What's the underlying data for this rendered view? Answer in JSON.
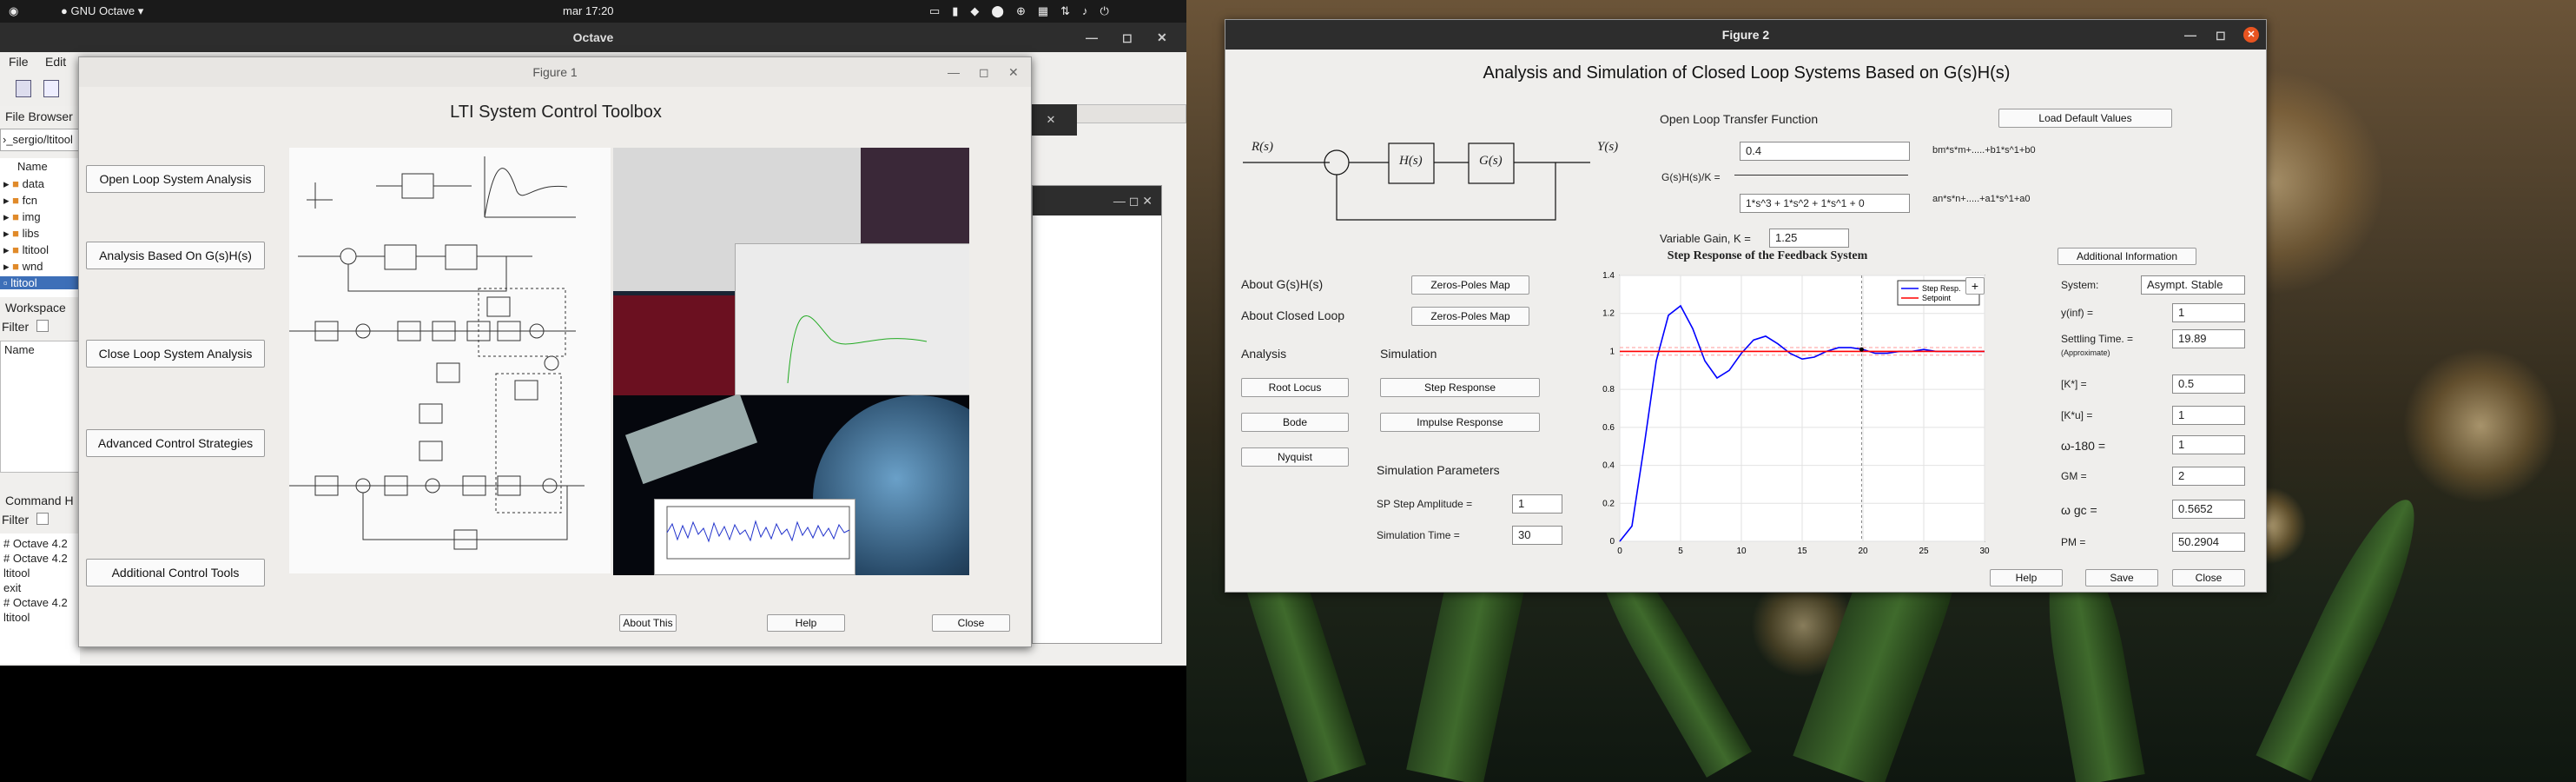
{
  "topbar": {
    "app": "GNU Octave",
    "clock": "mar 17:20",
    "activities_icon": "ubuntu-logo"
  },
  "octave_main": {
    "title": "Octave",
    "menu": [
      "File",
      "Edit"
    ],
    "file_browser_label": "File Browser",
    "path": "›_sergio/ltitool",
    "name_header": "Name",
    "files": [
      "data",
      "fcn",
      "img",
      "libs",
      "ltitool",
      "wnd",
      "ltitool"
    ],
    "workspace_label": "Workspace",
    "filter_label": "Filter",
    "ws_name_header": "Name",
    "command_history_label": "Command H",
    "cmd_filter_label": "Filter",
    "history": [
      "# Octave 4.2",
      "# Octave 4.2",
      "ltitool",
      "exit",
      "# Octave 4.2",
      "ltitool"
    ]
  },
  "figure1": {
    "title": "Figure 1",
    "heading": "LTI System Control Toolbox",
    "buttons": [
      "Open Loop System Analysis",
      "Analysis Based On G(s)H(s)",
      "Close Loop System Analysis",
      "Advanced Control Strategies",
      "Additional Control Tools"
    ],
    "about": "About This",
    "help": "Help",
    "close": "Close"
  },
  "figure2": {
    "title": "Figure 2",
    "heading": "Analysis and Simulation of Closed Loop Systems Based on G(s)H(s)",
    "block": {
      "input": "R(s)",
      "h": "H(s)",
      "g": "G(s)",
      "output": "Y(s)"
    },
    "oltf_label": "Open Loop Transfer Function",
    "load_defaults": "Load Default Values",
    "num_value": "0.4",
    "num_hint": "bm*s*m+.....+b1*s^1+b0",
    "gh_label": "G(s)H(s)/K =",
    "den_value": "1*s^3 + 1*s^2 + 1*s^1 + 0",
    "den_hint": "an*s*n+.....+a1*s^1+a0",
    "gain_label": "Variable Gain, K =",
    "gain_value": "1.25",
    "about_gh": "About G(s)H(s)",
    "about_cl": "About Closed Loop",
    "zp_btn": "Zeros-Poles Map",
    "analysis": "Analysis",
    "simulation": "Simulation",
    "root_locus": "Root Locus",
    "bode": "Bode",
    "nyquist": "Nyquist",
    "step_resp": "Step Response",
    "impulse_resp": "Impulse Response",
    "sim_params": "Simulation Parameters",
    "sp_amp_label": "SP Step Amplitude =",
    "sp_amp_value": "1",
    "sim_time_label": "Simulation Time =",
    "sim_time_value": "30",
    "help": "Help",
    "save": "Save",
    "close": "Close",
    "additional_info": "Additional Information",
    "info": [
      {
        "label": "System:",
        "value": "Asympt. Stable"
      },
      {
        "label": "y(inf) =",
        "value": "1"
      },
      {
        "label": "Settling Time. =",
        "sub": "(Approximate)",
        "value": "19.89"
      },
      {
        "label": "[K*] =",
        "value": "0.5"
      },
      {
        "label": "[K*u] =",
        "value": "1"
      },
      {
        "label": "ω-180 =",
        "value": "1"
      },
      {
        "label": "GM =",
        "value": "2"
      },
      {
        "label": "ω gc =",
        "value": "0.5652"
      },
      {
        "label": "PM =",
        "value": "50.2904"
      }
    ]
  },
  "chart_data": {
    "type": "line",
    "title": "Step Response of the Feedback System",
    "xlim": [
      0,
      30
    ],
    "ylim": [
      0,
      1.4
    ],
    "xticks": [
      0,
      5,
      10,
      15,
      20,
      25,
      30
    ],
    "yticks": [
      0,
      0.2,
      0.4,
      0.6,
      0.8,
      1,
      1.2,
      1.4
    ],
    "legend_position": "top-right",
    "series": [
      {
        "name": "Step Resp.",
        "color": "#0000ff",
        "x": [
          0,
          1,
          2,
          3,
          4,
          5,
          6,
          7,
          8,
          9,
          10,
          11,
          12,
          13,
          14,
          15,
          16,
          17,
          18,
          19,
          20,
          21,
          22,
          23,
          24,
          25,
          26,
          27,
          28,
          29,
          30
        ],
        "y": [
          0,
          0.08,
          0.5,
          0.95,
          1.19,
          1.24,
          1.12,
          0.95,
          0.86,
          0.9,
          0.99,
          1.06,
          1.08,
          1.04,
          0.99,
          0.96,
          0.97,
          1.0,
          1.02,
          1.02,
          1.01,
          0.99,
          0.99,
          1.0,
          1.0,
          1.01,
          1.0,
          1.0,
          1.0,
          1.0,
          1.0
        ]
      },
      {
        "name": "Setpoint",
        "color": "#ff0000",
        "x": [
          0,
          30
        ],
        "y": [
          1,
          1
        ]
      }
    ],
    "band_upper": 1.02,
    "band_lower": 0.98,
    "marker_x": 19.89
  }
}
